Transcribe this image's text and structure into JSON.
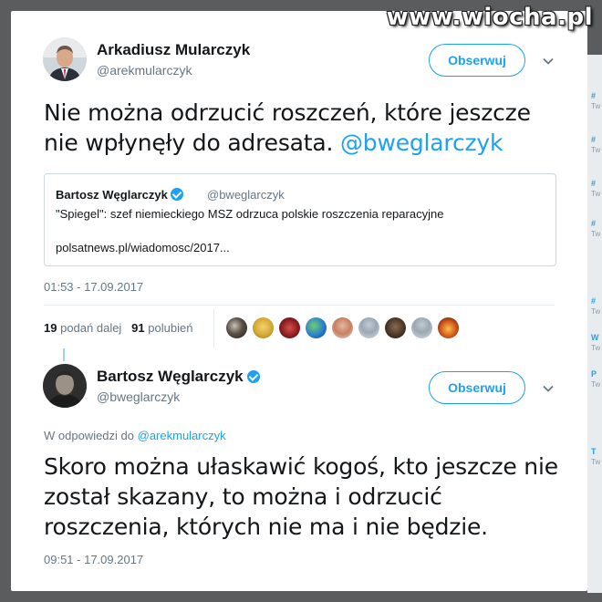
{
  "watermark": "www.wiocha.pl",
  "tweet1": {
    "author_name": "Arkadiusz Mularczyk",
    "author_handle": "@arekmularczyk",
    "follow_label": "Obserwuj",
    "text_line1": "Nie można odrzucić roszczeń, które jeszcze",
    "text_line2": "nie wpłynęły do adresata.",
    "text_mention": "@bweglarczyk",
    "quoted": {
      "name": "Bartosz Węglarczyk",
      "handle": "@bweglarczyk",
      "text": "\"Spiegel\": szef niemieckiego MSZ odrzuca polskie roszczenia reparacyjne",
      "link": "polsatnews.pl/wiadomosc/2017..."
    },
    "timestamp": "01:53 - 17.09.2017",
    "retweets_count": "19",
    "retweets_label": "podań dalej",
    "likes_count": "91",
    "likes_label": "polubień"
  },
  "tweet2": {
    "author_name": "Bartosz Węglarczyk",
    "author_handle": "@bweglarczyk",
    "follow_label": "Obserwuj",
    "reply_prefix": "W odpowiedzi do",
    "reply_mention": "@arekmularczyk",
    "text_line1": "Skoro można ułaskawić kogoś, kto jeszcze nie",
    "text_line2": "został skazany, to można i odrzucić",
    "text_line3": "roszczenia, których nie ma i nie będzie.",
    "timestamp": "09:51 - 17.09.2017"
  },
  "colors": {
    "accent": "#1da1f2",
    "text": "#14171a",
    "secondary": "#657786"
  },
  "icons": {
    "verified": "verified-badge-icon",
    "chevron": "chevron-down-icon"
  }
}
